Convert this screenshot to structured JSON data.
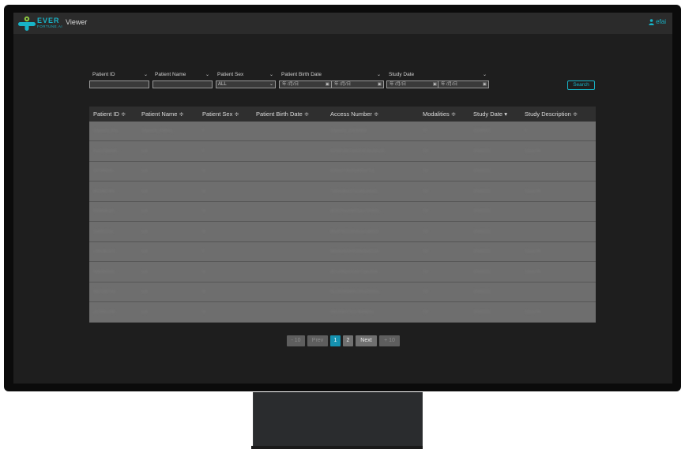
{
  "header": {
    "logo_text": "EVER",
    "logo_sub": "FORTUNE.AI",
    "app_title": "Viewer",
    "user": "efai",
    "accent": "#18b4c8"
  },
  "filters": {
    "patient_id": {
      "label": "Patient ID"
    },
    "patient_name": {
      "label": "Patient Name"
    },
    "patient_sex": {
      "label": "Patient Sex",
      "value": "ALL"
    },
    "birth_date": {
      "label": "Patient Birth Date",
      "from": "年 /月/日",
      "to": "年 /月/日"
    },
    "study_date": {
      "label": "Study Date",
      "from": "年 /月/日",
      "to": "年 /月/日"
    },
    "search_label": "Search"
  },
  "table": {
    "columns": [
      "Patient ID ≑",
      "Patient Name ≑",
      "Patient Sex ≑",
      "Patient Birth Date ≑",
      "Access Number ≑",
      "Modalities ≑",
      "Study Date ▾",
      "Study Description ≑"
    ],
    "rows": [
      [
        "Segment_Pat...",
        "Segment_Patient_...",
        "F",
        "",
        "Segment_1H1509E6",
        "CT",
        "20190531",
        "0"
      ],
      [
        "0cd1739e645...",
        "null",
        "F",
        "",
        "6029F1A913a6d24C0ba00a2E...",
        "CR",
        "20091221",
        "Chest PA"
      ],
      [
        "2079d45d5...",
        "null",
        "M",
        "",
        "6096e27f4d9b3f00fa7Tc6...",
        "CR",
        "20091221",
        ""
      ],
      [
        "8f2d4f874f4...",
        "null",
        "M",
        "",
        "7350e38eb27ecaf0c4ebe0...",
        "CR",
        "20091221",
        "Chest PA"
      ],
      [
        "63b8b4baf0...",
        "null",
        "M",
        "",
        "8E657faae6863bae7294bf3...",
        "CR",
        "20091221",
        ""
      ],
      [
        "3a993123a...",
        "null",
        "M",
        "",
        "8fadf7951236c6a1eca6f2d7...",
        "CR",
        "20091221",
        ""
      ],
      [
        "c2f5c8b1b7f...",
        "null",
        "F",
        "",
        "906dbefb34441f9e5bd3124...",
        "CR",
        "20091221",
        "Chest PA"
      ],
      [
        "f68b4b6342...",
        "null",
        "M",
        "",
        "8D7af96b2d1d6f71afcd606...",
        "CR",
        "20091221",
        "Chest PA"
      ],
      [
        "5bb7ab67e4...",
        "null",
        "M",
        "",
        "f9cc96abb8d5c2b6a00d55a...",
        "CR",
        "20091221",
        ""
      ],
      [
        "ab73f8cc5f8...",
        "null",
        "M",
        "",
        "6f8e4fd8d79c67fb6f6b5e...",
        "CR",
        "20091221",
        "Chest PA"
      ]
    ]
  },
  "pagination": {
    "minus10": "- 10",
    "prev": "Prev",
    "pages": [
      "1",
      "2"
    ],
    "current": "1",
    "next": "Next",
    "plus10": "+ 10"
  }
}
